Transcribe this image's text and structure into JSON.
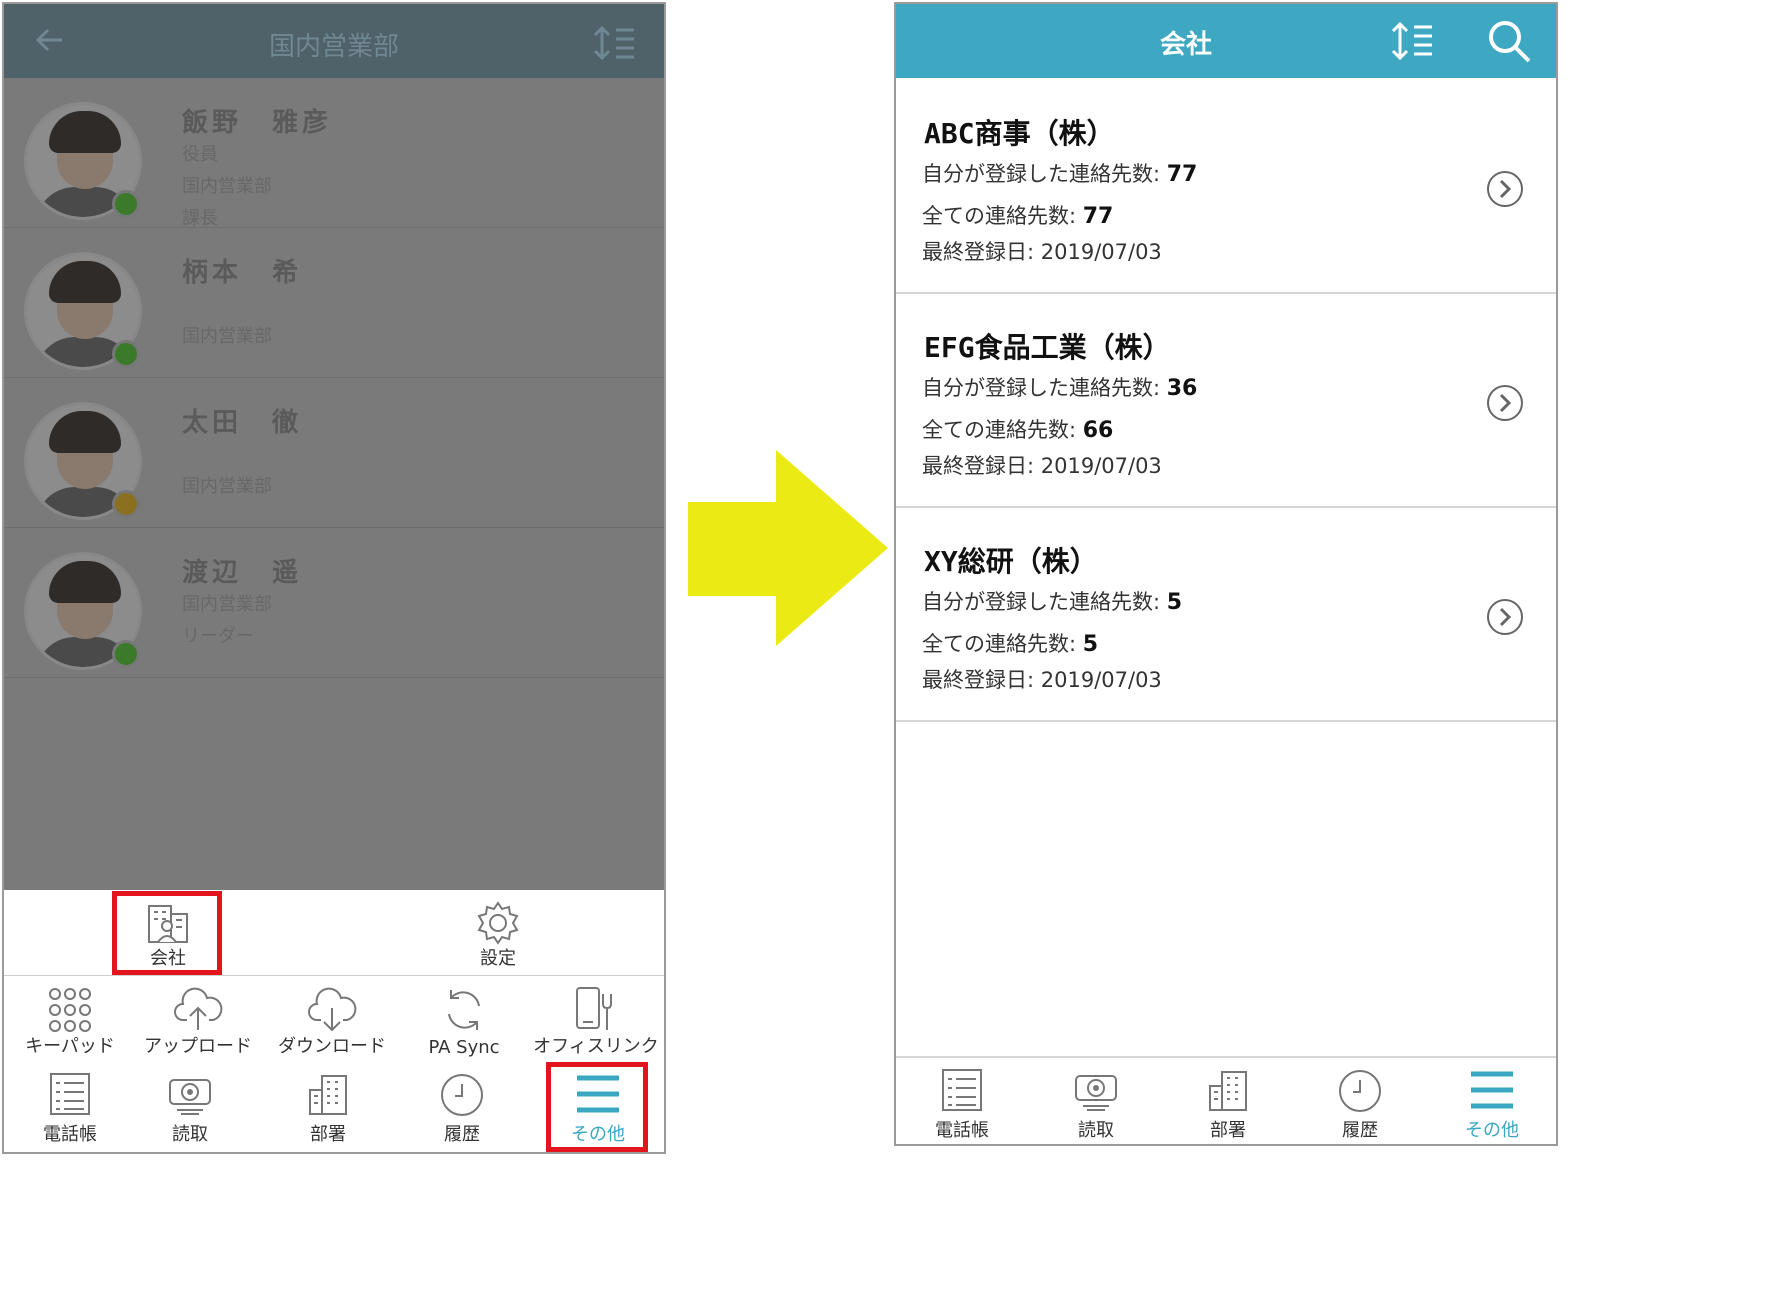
{
  "left": {
    "header": {
      "title": "国内営業部",
      "back_icon": "back-arrow-icon",
      "sort_icon": "sort-icon"
    },
    "contacts": [
      {
        "name": "飯野　雅彦",
        "lines": [
          "役員",
          "国内営業部",
          "課長"
        ],
        "status": "ok"
      },
      {
        "name": "柄本　希",
        "lines": [
          "",
          "国内営業部",
          ""
        ],
        "status": "ok"
      },
      {
        "name": "太田　徹",
        "lines": [
          "",
          "国内営業部",
          ""
        ],
        "status": "away"
      },
      {
        "name": "渡辺　遥",
        "lines": [
          "国内営業部",
          "リーダー",
          ""
        ],
        "status": "ok"
      }
    ],
    "more_panel": [
      {
        "label": "会社",
        "icon": "building-person-icon"
      },
      {
        "label": "設定",
        "icon": "gear-icon"
      }
    ],
    "tools": [
      {
        "label": "キーパッド",
        "icon": "keypad-icon"
      },
      {
        "label": "アップロード",
        "icon": "cloud-upload-icon"
      },
      {
        "label": "ダウンロード",
        "icon": "cloud-download-icon"
      },
      {
        "label": "PA Sync",
        "icon": "sync-icon"
      },
      {
        "label": "オフィスリンク",
        "icon": "office-link-icon"
      }
    ],
    "tabs": [
      {
        "label": "電話帳",
        "icon": "phonebook-icon"
      },
      {
        "label": "読取",
        "icon": "camera-icon"
      },
      {
        "label": "部署",
        "icon": "department-building-icon"
      },
      {
        "label": "履歴",
        "icon": "clock-icon"
      },
      {
        "label": "その他",
        "icon": "menu-icon",
        "active": true
      }
    ]
  },
  "right": {
    "header": {
      "title": "会社",
      "sort_icon": "sort-icon",
      "search_icon": "search-icon"
    },
    "companies": [
      {
        "name": "ABC商事（株）",
        "mine_label": "自分が登録した連絡先数: ",
        "mine": "77",
        "all_label": "全ての連絡先数: ",
        "all": "77",
        "last": "最終登録日: 2019/07/03"
      },
      {
        "name": "EFG食品工業（株）",
        "mine_label": "自分が登録した連絡先数: ",
        "mine": "36",
        "all_label": "全ての連絡先数: ",
        "all": "66",
        "last": "最終登録日: 2019/07/03"
      },
      {
        "name": "XY総研（株）",
        "mine_label": "自分が登録した連絡先数: ",
        "mine": "5",
        "all_label": "全ての連絡先数: ",
        "all": "5",
        "last": "最終登録日: 2019/07/03"
      }
    ],
    "tabs": [
      {
        "label": "電話帳",
        "icon": "phonebook-icon"
      },
      {
        "label": "読取",
        "icon": "camera-icon"
      },
      {
        "label": "部署",
        "icon": "department-building-icon"
      },
      {
        "label": "履歴",
        "icon": "clock-icon"
      },
      {
        "label": "その他",
        "icon": "menu-icon",
        "active": true
      }
    ]
  },
  "colors": {
    "header_teal": "#3ea8c2",
    "highlight_red": "#e3141d",
    "arrow_yellow": "#ecea14",
    "active_tab": "#3aa7c1"
  }
}
